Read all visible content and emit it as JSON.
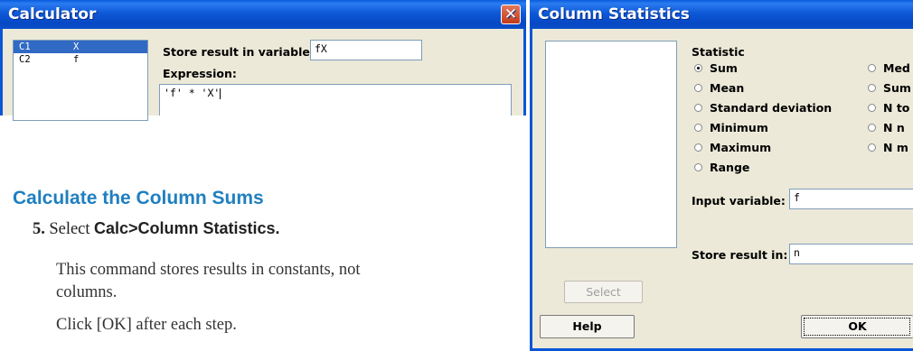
{
  "calculator": {
    "title": "Calculator",
    "close_glyph": "✕",
    "columns": [
      {
        "id": "C1",
        "name": "X",
        "selected": true
      },
      {
        "id": "C2",
        "name": "f",
        "selected": false
      }
    ],
    "store_label": "Store result in variable:",
    "store_value": "fX",
    "expression_label": "Expression:",
    "expression_value": "'f' * 'X'"
  },
  "instructions": {
    "heading": "Calculate the Column Sums",
    "step_number": "5.",
    "step_prefix": "Select",
    "step_command": "Calc>Column Statistics.",
    "paragraph_1_line1": "This command stores results in constants, not",
    "paragraph_1_line2": "columns.",
    "paragraph_2": "Click [OK] after each step."
  },
  "column_statistics": {
    "title": "Column Statistics",
    "statistic_label": "Statistic",
    "statistics_col1": [
      {
        "label": "Sum",
        "selected": true
      },
      {
        "label": "Mean",
        "selected": false
      },
      {
        "label": "Standard deviation",
        "selected": false
      },
      {
        "label": "Minimum",
        "selected": false
      },
      {
        "label": "Maximum",
        "selected": false
      },
      {
        "label": "Range",
        "selected": false
      }
    ],
    "statistics_col2": [
      {
        "label": "Med",
        "selected": false
      },
      {
        "label": "Sum",
        "selected": false
      },
      {
        "label": "N to",
        "selected": false
      },
      {
        "label": "N n",
        "selected": false
      },
      {
        "label": "N m",
        "selected": false
      }
    ],
    "input_variable_label": "Input variable:",
    "input_variable_value": "f",
    "store_result_label": "Store result in:",
    "store_result_value": "n",
    "select_button": "Select",
    "help_button": "Help",
    "ok_button": "OK"
  },
  "colors": {
    "titlebar": "#0a56d6",
    "dialog_face": "#ece9d8",
    "heading": "#1f7fc0",
    "selection": "#316ac5"
  }
}
